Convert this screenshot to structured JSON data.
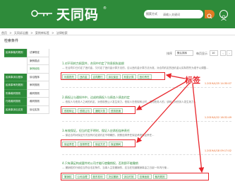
{
  "header": {
    "logo_text": "天同码",
    "logo_reg": "®",
    "search_select": "搜索方式",
    "search_placeholder": "请输入关键词",
    "brand_color": "#2e8b3a",
    "accent_color": "#e07b23"
  },
  "breadcrumb": [
    "首页",
    ">",
    "天同诉讼圈",
    ">",
    "案例库标签",
    ">",
    "法律检索"
  ],
  "page_label": "检索条件",
  "sidebar": {
    "rows": [
      {
        "left": "民商事裁判规则",
        "right": "法律规定"
      },
      {
        "left": "",
        "right": "案例观点"
      },
      {
        "left": "",
        "right": "案例经验"
      },
      {
        "left": "民商事诉讼程序",
        "right": "诉讼程序"
      },
      {
        "left": "民商事审判规则",
        "right": "审判规则"
      },
      {
        "left": "刑事裁判规则",
        "right": "裁判规则"
      },
      {
        "left": "行政裁判规则",
        "right": "裁判规则"
      },
      {
        "left": "民商事诉讼实务",
        "right": "诉讼实务"
      }
    ]
  },
  "toolbar": {
    "sort_label": "排序",
    "sort_value": "默认排序",
    "per_page_label": "每页显示",
    "per_page_value": "10",
    "prev": "‹",
    "next": "›"
  },
  "questions": [
    {
      "title": "1.对不同的力损案件，合同中约定了利息损失赔偿",
      "text": "— 在合同中已约定了违约金，又约定了违约金计算方法的，应以违约金计算方法为准，对合同约定的违约金以实际损失为准予以调整...",
      "tags": [
        "利息损失",
        "违约金",
        "合同履行",
        "诉讼保全",
        "利息计算",
        "违约责任"
      ],
      "date": "1.2019/4/25 14:30:07"
    },
    {
      "title": "2.债权让与通知书中，达成的债权人与债务人债务约定",
      "text": "— 债权人与债务人之间的约定，对债权受让人发生效力。债权人在债权转让时，通知债务人的，该转让对债务人发生效力...",
      "tags": [
        "债权转让",
        "债权让与",
        "通知义务",
        "债务抵销"
      ],
      "date": "1.2019/4/22 16:32:49"
    },
    {
      "title": "3.有效保证，但当约定不明时，保证人应承担连带责任",
      "text": "— 保证合同对保证方式没有约定或约定不明确的，按照连带责任保证承担保证责任...",
      "tags": [
        "保证责任",
        "连带责任",
        "保证方式",
        "保证期间"
      ],
      "date": "1.2019/4/18 09:17:02"
    },
    {
      "title": "4.只有满足构成要件的公司才能行使撤销权，否则即不能撤销",
      "text": "— 撤销权的行使应当符合法定条件，当事人主张撤销的，应当在知道撤销事由之日起一年内行使...",
      "tags": [
        "撤销权",
        "公司治理",
        "股东权利",
        "决议撤销",
        "诉讼时效",
        "法律适用",
        "裁判规则"
      ],
      "date": ""
    }
  ],
  "annotation": {
    "label": "标签",
    "color": "#e8262c"
  }
}
